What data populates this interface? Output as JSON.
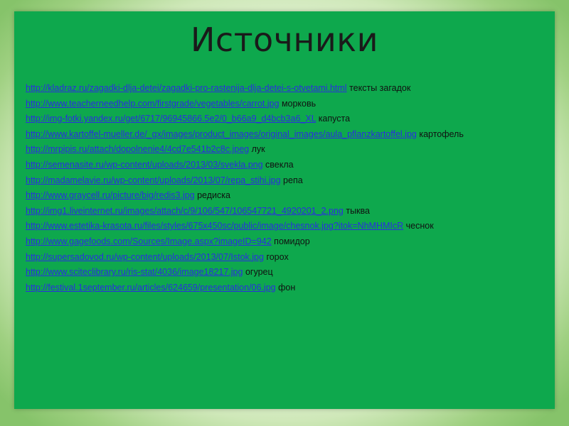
{
  "slide": {
    "title": "Источники",
    "sources": [
      {
        "url": "http://kladraz.ru/zagadki-dlja-detei/zagadki-pro-rastenija-dlja-detei-s-otvetami.html",
        "description": "тексты загадок"
      },
      {
        "url": "http://www.teacherneedhelp.com/firstgrade/vegetables/carrot.jpg",
        "description": "морковь"
      },
      {
        "url": "http://img-fotki.yandex.ru/get/6717/96945866.5e2/0_b66a9_d4bcb3a6_XL",
        "description": "капуста"
      },
      {
        "url": "http://www.kartoffel-mueller.de/_gx/images/product_images/original_images/aula_pflanzkartoffel.jpg",
        "description": "картофель"
      },
      {
        "url": "http://mrpipis.ru/attach/dopolnenie4/4cd7e541b2c8c.jpeg",
        "description": "лук"
      },
      {
        "url": "http://semenasite.ru/wp-content/uploads/2013/03/svekla.png",
        "description": "свекла"
      },
      {
        "url": "http://madamelavie.ru/wp-content/uploads/2013/07/repa_stihi.jpg",
        "description": "репа"
      },
      {
        "url": "http://www.graycell.ru/picture/big/redis3.jpg",
        "description": "редиска"
      },
      {
        "url": "http://img1.liveinternet.ru/images/attach/c/9/106/547/106547721_4920201_2.png",
        "description": "тыква"
      },
      {
        "url": "http://www.estetika-krasota.ru/files/styles/675x450sc/public/image/chesnok.jpg?itok=NhMHMIcR",
        "description": "чеснок"
      },
      {
        "url": "http://www.gagefoods.com/Sources/Image.aspx?imageID=942",
        "description": "помидор"
      },
      {
        "url": "http://supersadovod.ru/wp-content/uploads/2013/07/Istok.jpg",
        "description": "горох"
      },
      {
        "url": "http://www.sciteclibrary.ru/ris-stat/4036/image18217.jpg",
        "description": "огурец"
      },
      {
        "url": "http://festival.1september.ru/articles/624659/presentation/06.jpg",
        "description": "фон"
      }
    ]
  },
  "colors": {
    "slide_background": "#0ea84d",
    "link": "#2a2ee0",
    "text": "#111111"
  }
}
